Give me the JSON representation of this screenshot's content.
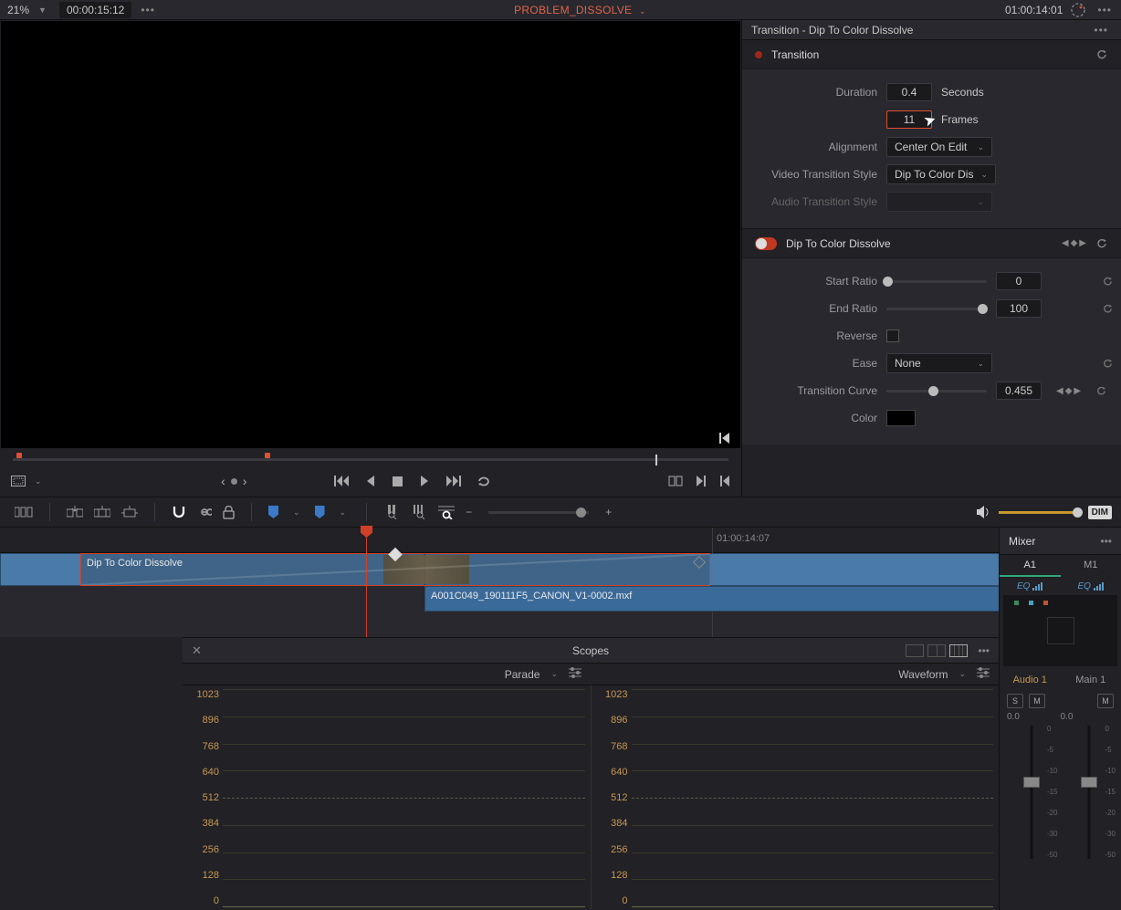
{
  "top": {
    "zoom": "21%",
    "timecode_left": "00:00:15:12",
    "title": "PROBLEM_DISSOLVE",
    "timecode_right": "01:00:14:01"
  },
  "inspector": {
    "title": "Transition - Dip To Color Dissolve",
    "section1": "Transition",
    "duration_label": "Duration",
    "duration_sec": "0.4",
    "unit_seconds": "Seconds",
    "duration_frames": "11",
    "unit_frames": "Frames",
    "alignment_label": "Alignment",
    "alignment_value": "Center On Edit",
    "vts_label": "Video Transition Style",
    "vts_value": "Dip To Color Dis",
    "ats_label": "Audio Transition Style",
    "ats_value": "",
    "section2": "Dip To Color Dissolve",
    "start_ratio_label": "Start Ratio",
    "start_ratio_value": "0",
    "end_ratio_label": "End Ratio",
    "end_ratio_value": "100",
    "reverse_label": "Reverse",
    "ease_label": "Ease",
    "ease_value": "None",
    "tcurve_label": "Transition Curve",
    "tcurve_value": "0.455",
    "color_label": "Color"
  },
  "timeline": {
    "ruler_tc": "01:00:14:07",
    "transition_name": "Dip To Color Dissolve",
    "audio_clip": "A001C049_190111F5_CANON_V1-0002.mxf"
  },
  "toolbar": {
    "dim": "DIM"
  },
  "mixer": {
    "title": "Mixer",
    "tab_a1": "A1",
    "tab_m1": "M1",
    "eq": "EQ",
    "audio1": "Audio 1",
    "main1": "Main 1",
    "s": "S",
    "m": "M",
    "db0": "0.0",
    "ticks": [
      "0",
      "-5",
      "-10",
      "-15",
      "-20",
      "-30",
      "-50"
    ]
  },
  "scopes": {
    "title": "Scopes",
    "left_mode": "Parade",
    "right_mode": "Waveform",
    "ylabels": [
      "1023",
      "896",
      "768",
      "640",
      "512",
      "384",
      "256",
      "128",
      "0"
    ]
  }
}
